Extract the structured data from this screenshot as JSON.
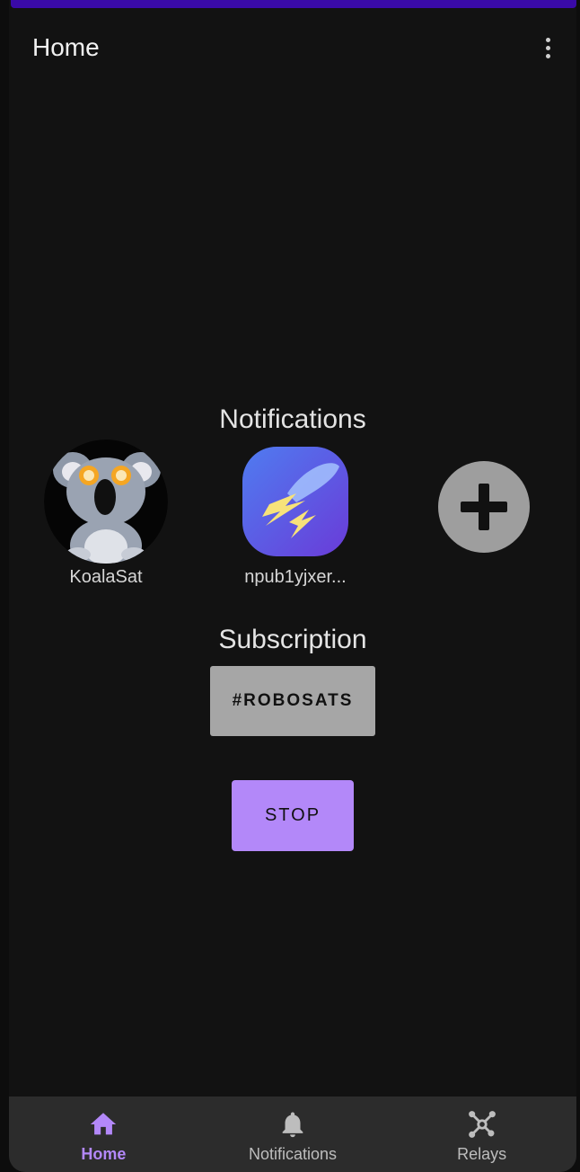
{
  "app_bar": {
    "title": "Home",
    "overflow_icon": "more-vert-icon"
  },
  "notifications": {
    "heading": "Notifications",
    "accounts": [
      {
        "label": "KoalaSat",
        "avatar": "koala-avatar"
      },
      {
        "label": "npub1yjxer...",
        "avatar": "lightning-app-avatar"
      }
    ],
    "add_icon": "add-icon"
  },
  "subscription": {
    "heading": "Subscription",
    "tag": "#ROBOSATS"
  },
  "actions": {
    "stop_label": "STOP"
  },
  "bottom_nav": {
    "items": [
      {
        "label": "Home",
        "icon": "home-icon",
        "active": true
      },
      {
        "label": "Notifications",
        "icon": "bell-icon",
        "active": false
      },
      {
        "label": "Relays",
        "icon": "network-icon",
        "active": false
      }
    ]
  },
  "colors": {
    "accent": "#b388f9",
    "status_bar": "#3a0aa8",
    "background": "#121212",
    "nav_background": "#2c2c2c",
    "chip": "#a6a6a6"
  }
}
